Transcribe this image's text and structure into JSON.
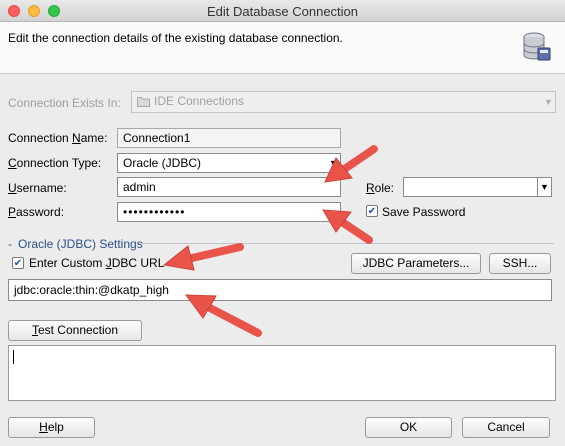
{
  "window": {
    "title": "Edit Database Connection"
  },
  "header": {
    "description": "Edit the connection details of the existing database connection.",
    "icon": "database-icon"
  },
  "connection_exists_in": {
    "label": "Connection Exists In:",
    "value": "IDE Connections",
    "icon": "folder-icon"
  },
  "connection_name": {
    "label_pre": "Connection ",
    "label_mnemonic": "N",
    "label_post": "ame:",
    "value": "Connection1"
  },
  "connection_type": {
    "label_pre": "",
    "label_mnemonic": "C",
    "label_post": "onnection Type:",
    "value": "Oracle (JDBC)"
  },
  "username": {
    "label_pre": "",
    "label_mnemonic": "U",
    "label_post": "sername:",
    "value": "admin"
  },
  "password": {
    "label_pre": "",
    "label_mnemonic": "P",
    "label_post": "assword:",
    "value": "••••••••••••"
  },
  "role": {
    "label_pre": "",
    "label_mnemonic": "R",
    "label_post": "ole:",
    "value": ""
  },
  "save_password": {
    "label": "Save Password",
    "checked": true
  },
  "oracle_settings": {
    "label": "Oracle (JDBC) Settings"
  },
  "custom_jdbc": {
    "label_pre": "Enter Custom ",
    "label_mnemonic": "J",
    "label_post": "DBC URL",
    "checked": true
  },
  "jdbc_parameters_button": "JDBC Parameters...",
  "ssh_button": "SSH...",
  "jdbc_url": "jdbc:oracle:thin:@dkatp_high",
  "test_connection_button": {
    "mnemonic": "T",
    "rest": "est Connection"
  },
  "footer": {
    "help": {
      "mnemonic": "H",
      "rest": "elp"
    },
    "ok": "OK",
    "cancel": "Cancel"
  },
  "colors": {
    "arrow": "#e9544a",
    "checkmark": "#1d4fb5"
  }
}
